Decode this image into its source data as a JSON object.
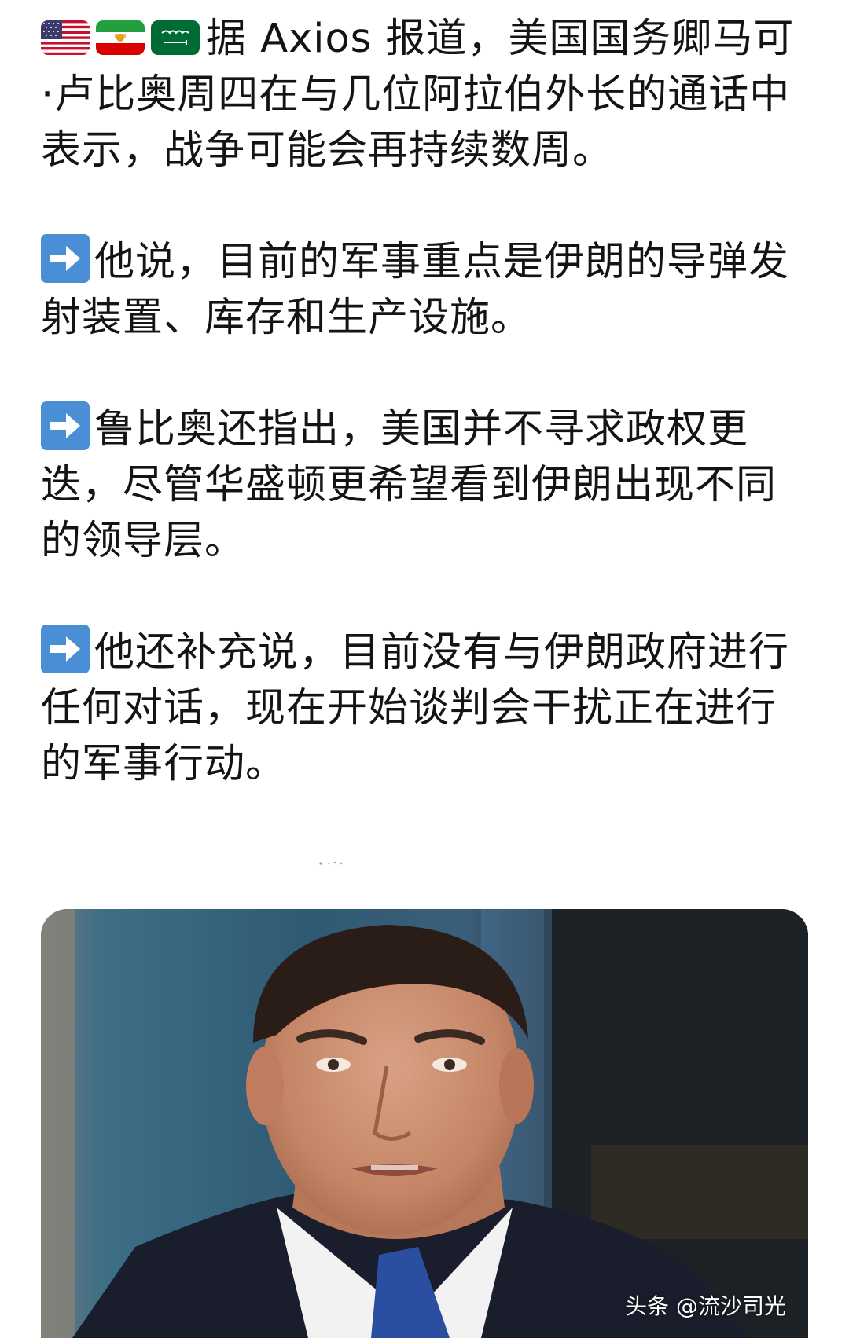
{
  "post": {
    "paragraphs": [
      {
        "icons": [
          "us-flag-icon",
          "iran-flag-icon",
          "saudi-flag-icon"
        ],
        "text": "据 Axios 报道，美国国务卿马可·卢比奥周四在与几位阿拉伯外长的通话中表示，战争可能会再持续数周。"
      },
      {
        "icons": [
          "right-arrow-icon"
        ],
        "text": "他说，目前的军事重点是伊朗的导弹发射装置、库存和生产设施。"
      },
      {
        "icons": [
          "right-arrow-icon"
        ],
        "text": "鲁比奥还指出，美国并不寻求政权更迭，尽管华盛顿更希望看到伊朗出现不同的领导层。"
      },
      {
        "icons": [
          "right-arrow-icon"
        ],
        "text": "他还补充说，目前没有与伊朗政府进行任何对话，现在开始谈判会干扰正在进行的军事行动。"
      }
    ]
  },
  "image": {
    "watermark": "头条 @流沙司光"
  },
  "colors": {
    "text": "#141414",
    "arrow_box": "#4a8fd6",
    "background": "#ffffff"
  }
}
